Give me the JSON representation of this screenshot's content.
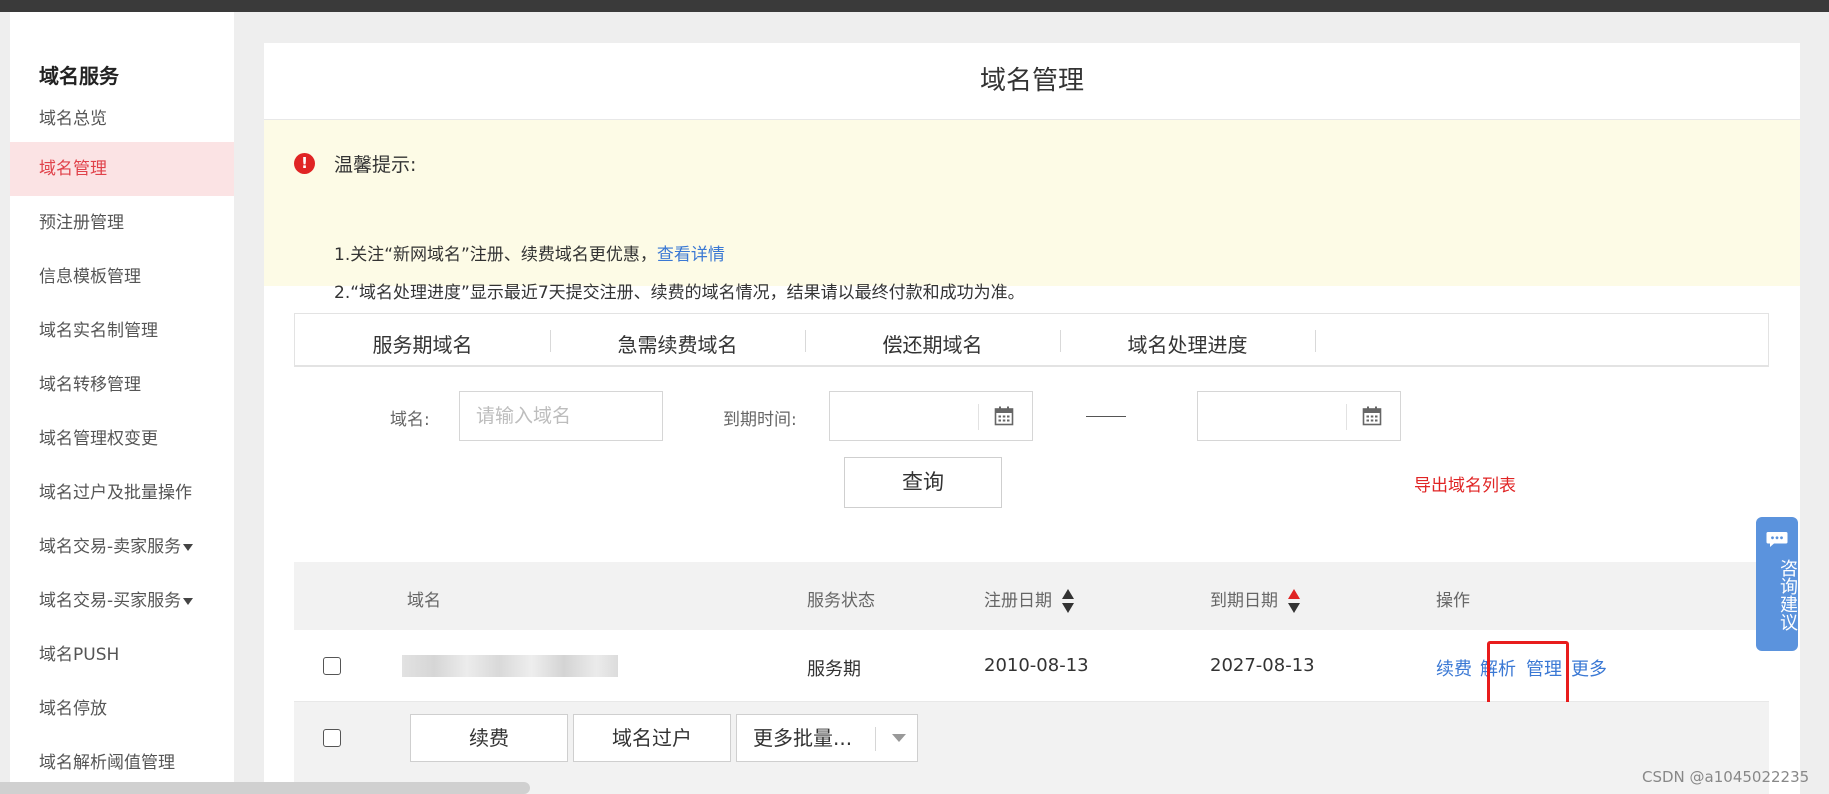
{
  "sidebar": {
    "title": "域名服务",
    "items": [
      {
        "label": "域名总览"
      },
      {
        "label": "域名管理",
        "active": true
      },
      {
        "label": "预注册管理"
      },
      {
        "label": "信息模板管理"
      },
      {
        "label": "域名实名制管理"
      },
      {
        "label": "域名转移管理"
      },
      {
        "label": "域名管理权变更"
      },
      {
        "label": "域名过户及批量操作"
      },
      {
        "label": "域名交易-卖家服务"
      },
      {
        "label": "域名交易-买家服务"
      },
      {
        "label": "域名PUSH"
      },
      {
        "label": "域名停放"
      },
      {
        "label": "域名解析阈值管理"
      }
    ]
  },
  "page": {
    "title": "域名管理"
  },
  "notice": {
    "title": "温馨提示:",
    "line1": "1.关注“新网域名”注册、续费域名更优惠，",
    "line1_link": "查看详情",
    "line2": "2.“域名处理进度”显示最近7天提交注册、续费的域名情况，结果请以最终付款和成功为准。"
  },
  "tabs": [
    {
      "label": "服务期域名"
    },
    {
      "label": "急需续费域名"
    },
    {
      "label": "偿还期域名"
    },
    {
      "label": "域名处理进度"
    }
  ],
  "filter": {
    "domain_label": "域名:",
    "domain_placeholder": "请输入域名",
    "expire_label": "到期时间:",
    "query_button": "查询",
    "export_link": "导出域名列表"
  },
  "table": {
    "headers": {
      "domain": "域名",
      "status": "服务状态",
      "reg_date": "注册日期",
      "expire_date": "到期日期",
      "actions": "操作"
    },
    "rows": [
      {
        "status": "服务期",
        "reg_date": "2010-08-13",
        "expire_date": "2027-08-13",
        "actions": [
          "续费",
          "解析",
          "管理",
          "更多"
        ]
      }
    ]
  },
  "batch": {
    "renew": "续费",
    "transfer": "域名过户",
    "more": "更多批量..."
  },
  "consult": {
    "label": "咨询建议"
  },
  "watermark": "CSDN @a1045022235",
  "colors": {
    "accent_red": "#e02424",
    "link_blue": "#3a78d4",
    "active_bg": "#fbe3e4",
    "notice_bg": "#fdfbe6"
  }
}
